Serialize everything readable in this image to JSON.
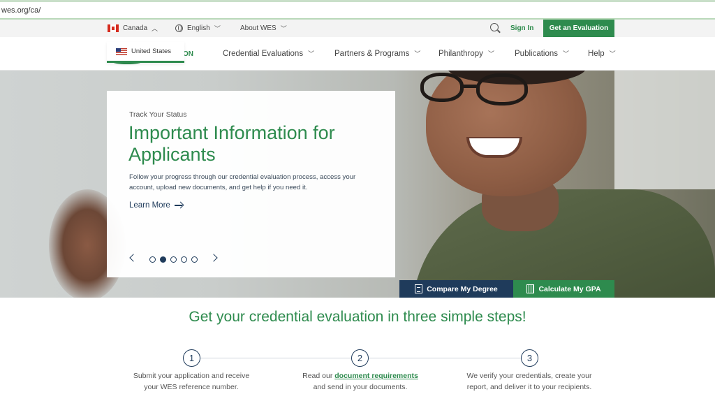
{
  "address_bar": {
    "url": "wes.org/ca/"
  },
  "utility_bar": {
    "country": "Canada",
    "language": "English",
    "about": "About WES",
    "sign_in": "Sign In",
    "cta": "Get an Evaluation"
  },
  "logo": {
    "fragment": "ON"
  },
  "country_dropdown": {
    "option": "United States"
  },
  "nav": {
    "items": [
      {
        "label": "Credential Evaluations"
      },
      {
        "label": "Partners & Programs"
      },
      {
        "label": "Philanthropy"
      },
      {
        "label": "Publications"
      },
      {
        "label": "Help"
      }
    ]
  },
  "hero": {
    "eyebrow": "Track Your Status",
    "title": "Important Information for Applicants",
    "description": "Follow your progress through our credential evaluation process, access your account, upload new documents, and get help if you need it.",
    "link": "Learn More",
    "carousel": {
      "total": 5,
      "active": 2
    }
  },
  "quick_actions": {
    "compare": "Compare My Degree",
    "gpa": "Calculate My GPA"
  },
  "steps": {
    "title": "Get your credential evaluation in three simple steps!",
    "items": [
      {
        "number": "1",
        "text": "Submit your application and receive your WES reference number."
      },
      {
        "number": "2",
        "text_before": "Read our ",
        "link": "document requirements",
        "text_after": " and send in your documents."
      },
      {
        "number": "3",
        "text": "We verify your credentials, create your report, and deliver it to your recipients."
      }
    ]
  },
  "colors": {
    "brand_green": "#2e8b4e",
    "navy": "#1f3b5b"
  }
}
